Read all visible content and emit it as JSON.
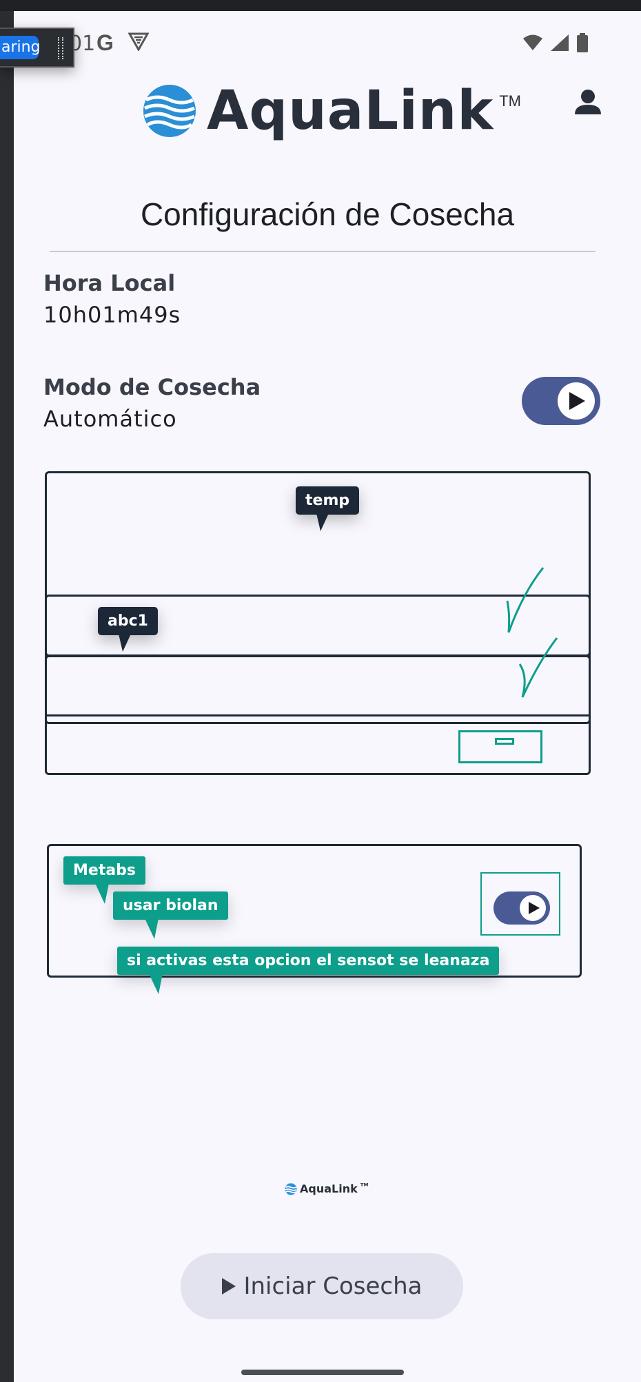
{
  "status_bar": {
    "time_partial": "01",
    "g_letter": "G"
  },
  "share_chip": {
    "label": "aring"
  },
  "header": {
    "brand": "AquaLink",
    "trademark": "TM"
  },
  "page": {
    "title": "Configuración de Cosecha"
  },
  "local_time": {
    "label": "Hora Local",
    "value": "10h01m49s"
  },
  "harvest_mode": {
    "label": "Modo de Cosecha",
    "value": "Automático",
    "toggle_on": true
  },
  "annotations": {
    "temp": "temp",
    "abc1": "abc1",
    "metabs": "Metabs",
    "usar_biolan": "usar biolan",
    "sensor_note": "si activas esta opcion el sensot se leanaza"
  },
  "footer": {
    "brand": "AquaLink",
    "trademark": "TM"
  },
  "start_button": {
    "label": "Iniciar Cosecha"
  },
  "colors": {
    "accent": "#4a5a94",
    "teal": "#0d9e8c",
    "dark": "#1c2737",
    "background": "#f7f7fd"
  }
}
